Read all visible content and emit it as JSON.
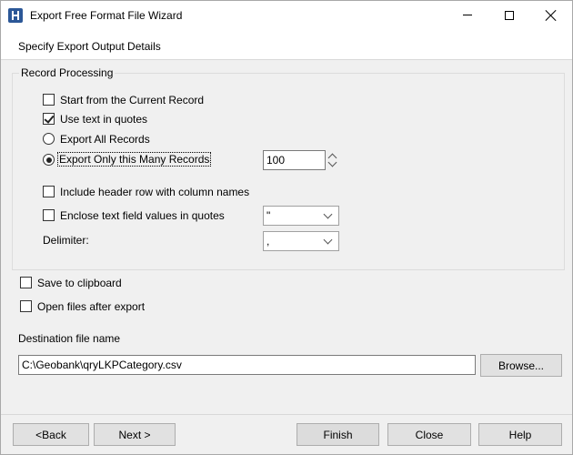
{
  "window": {
    "title": "Export Free Format File Wizard"
  },
  "header": {
    "subtitle": "Specify Export Output Details"
  },
  "record_processing": {
    "legend": "Record Processing",
    "start_current": {
      "label": "Start from the Current Record",
      "checked": false
    },
    "use_quotes": {
      "label": "Use text in quotes",
      "checked": true
    },
    "export_all": {
      "label": "Export All Records",
      "selected": false
    },
    "export_many": {
      "label": "Export Only this Many Records",
      "selected": true
    },
    "record_count": "100",
    "include_header": {
      "label": "Include header row with column names",
      "checked": false
    },
    "enclose_text": {
      "label": "Enclose text field values in quotes",
      "checked": false
    },
    "quote_char": "\"",
    "delimiter_label": "Delimiter:",
    "delimiter": ","
  },
  "options": {
    "save_clipboard": {
      "label": "Save to clipboard",
      "checked": false
    },
    "open_after": {
      "label": "Open files after export",
      "checked": false
    }
  },
  "destination": {
    "label": "Destination file name",
    "value": "C:\\Geobank\\qryLKPCategory.csv",
    "browse_label": "Browse..."
  },
  "footer": {
    "back_label": "<Back",
    "next_label": "Next >",
    "finish_label": "Finish",
    "close_label": "Close",
    "help_label": "Help"
  }
}
